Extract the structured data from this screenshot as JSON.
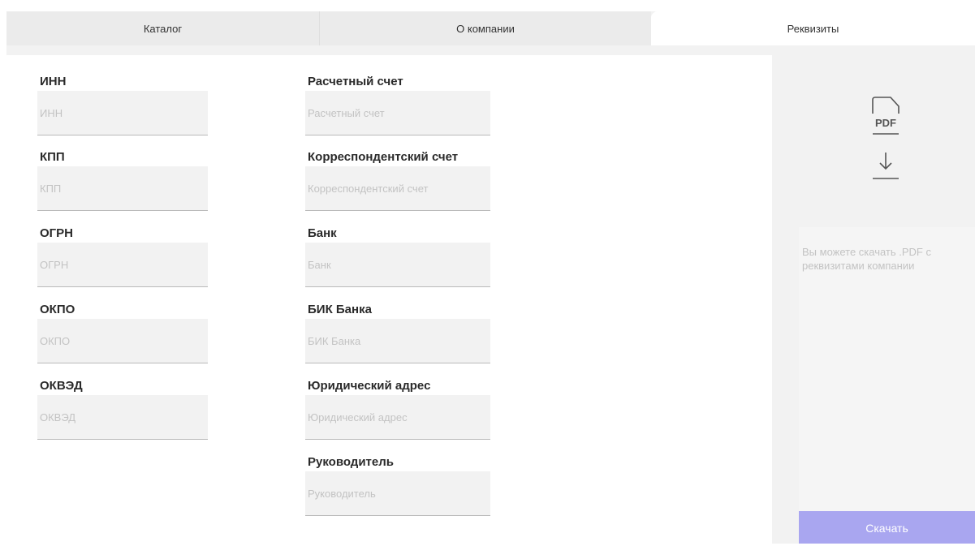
{
  "tabs": [
    {
      "label": "Каталог"
    },
    {
      "label": "О компании"
    },
    {
      "label": "Реквизиты"
    }
  ],
  "form": {
    "left": [
      {
        "label": "ИНН",
        "placeholder": "ИНН",
        "value": ""
      },
      {
        "label": "КПП",
        "placeholder": "КПП",
        "value": ""
      },
      {
        "label": "ОГРН",
        "placeholder": "ОГРН",
        "value": ""
      },
      {
        "label": "ОКПО",
        "placeholder": "ОКПО",
        "value": ""
      },
      {
        "label": "ОКВЭД",
        "placeholder": "ОКВЭД",
        "value": ""
      }
    ],
    "right": [
      {
        "label": "Расчетный счет",
        "placeholder": "Расчетный счет",
        "value": ""
      },
      {
        "label": "Корреспондентский счет",
        "placeholder": "Корреспондентский счет",
        "value": ""
      },
      {
        "label": "Банк",
        "placeholder": "Банк",
        "value": ""
      },
      {
        "label": "БИК Банка",
        "placeholder": "БИК Банка",
        "value": ""
      },
      {
        "label": "Юридический адрес",
        "placeholder": "Юридический адрес",
        "value": ""
      },
      {
        "label": "Руководитель",
        "placeholder": "Руководитель",
        "value": ""
      }
    ]
  },
  "pdf": {
    "icon_text": "PDF",
    "icon": "pdf-download-icon",
    "description": "Вы можете скачать .PDF с реквизитами компании",
    "button_label": "Скачать"
  },
  "colors": {
    "accent": "#a9a6f0",
    "active_tab": "#ffffff",
    "inactive_tab": "#ebebeb",
    "placeholder": "#c3c3c3"
  }
}
